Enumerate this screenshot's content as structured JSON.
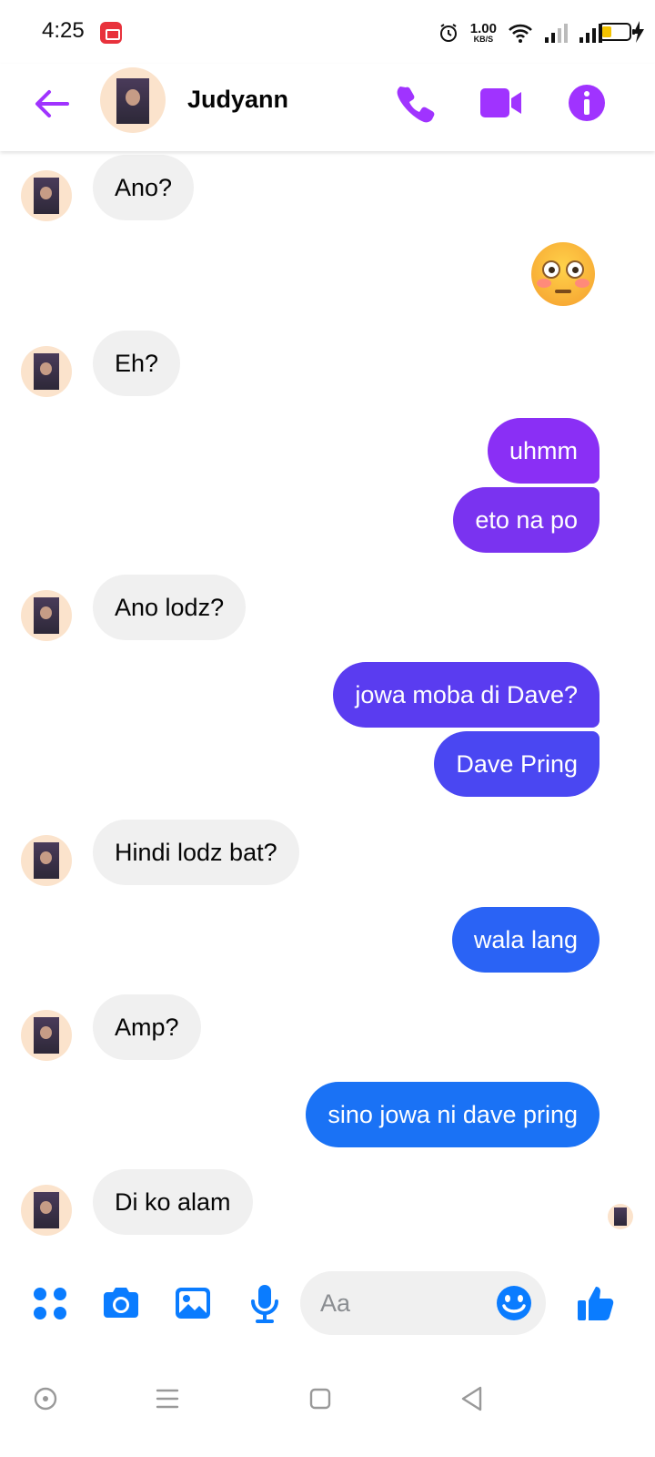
{
  "status_bar": {
    "time": "4:25",
    "speed_value": "1.00",
    "speed_unit": "KB/S",
    "battery_level": 0.25
  },
  "header": {
    "contact_name": "Judyann",
    "accent_color": "#a033ff"
  },
  "messages": [
    {
      "dir": "in",
      "text": "Ano?"
    },
    {
      "dir": "out",
      "emoji": "flushed-face"
    },
    {
      "dir": "in",
      "text": "Eh?"
    },
    {
      "dir": "out",
      "text": "uhmm",
      "color": "#8a2ff5"
    },
    {
      "dir": "out",
      "text": "eto na po",
      "color": "#7a33f0"
    },
    {
      "dir": "in",
      "text": "Ano lodz?"
    },
    {
      "dir": "out",
      "text": "jowa moba di Dave?",
      "color": "#5a3cf0"
    },
    {
      "dir": "out",
      "text": "Dave Pring",
      "color": "#4a47f2"
    },
    {
      "dir": "in",
      "text": "Hindi lodz bat?"
    },
    {
      "dir": "out",
      "text": "wala lang",
      "color": "#2a63f5"
    },
    {
      "dir": "in",
      "text": "Amp?"
    },
    {
      "dir": "out",
      "text": "sino jowa ni dave pring",
      "color": "#1a72f5"
    },
    {
      "dir": "in",
      "text": "Di ko alam"
    }
  ],
  "composer": {
    "placeholder": "Aa",
    "icon_color": "#0a7cff"
  }
}
